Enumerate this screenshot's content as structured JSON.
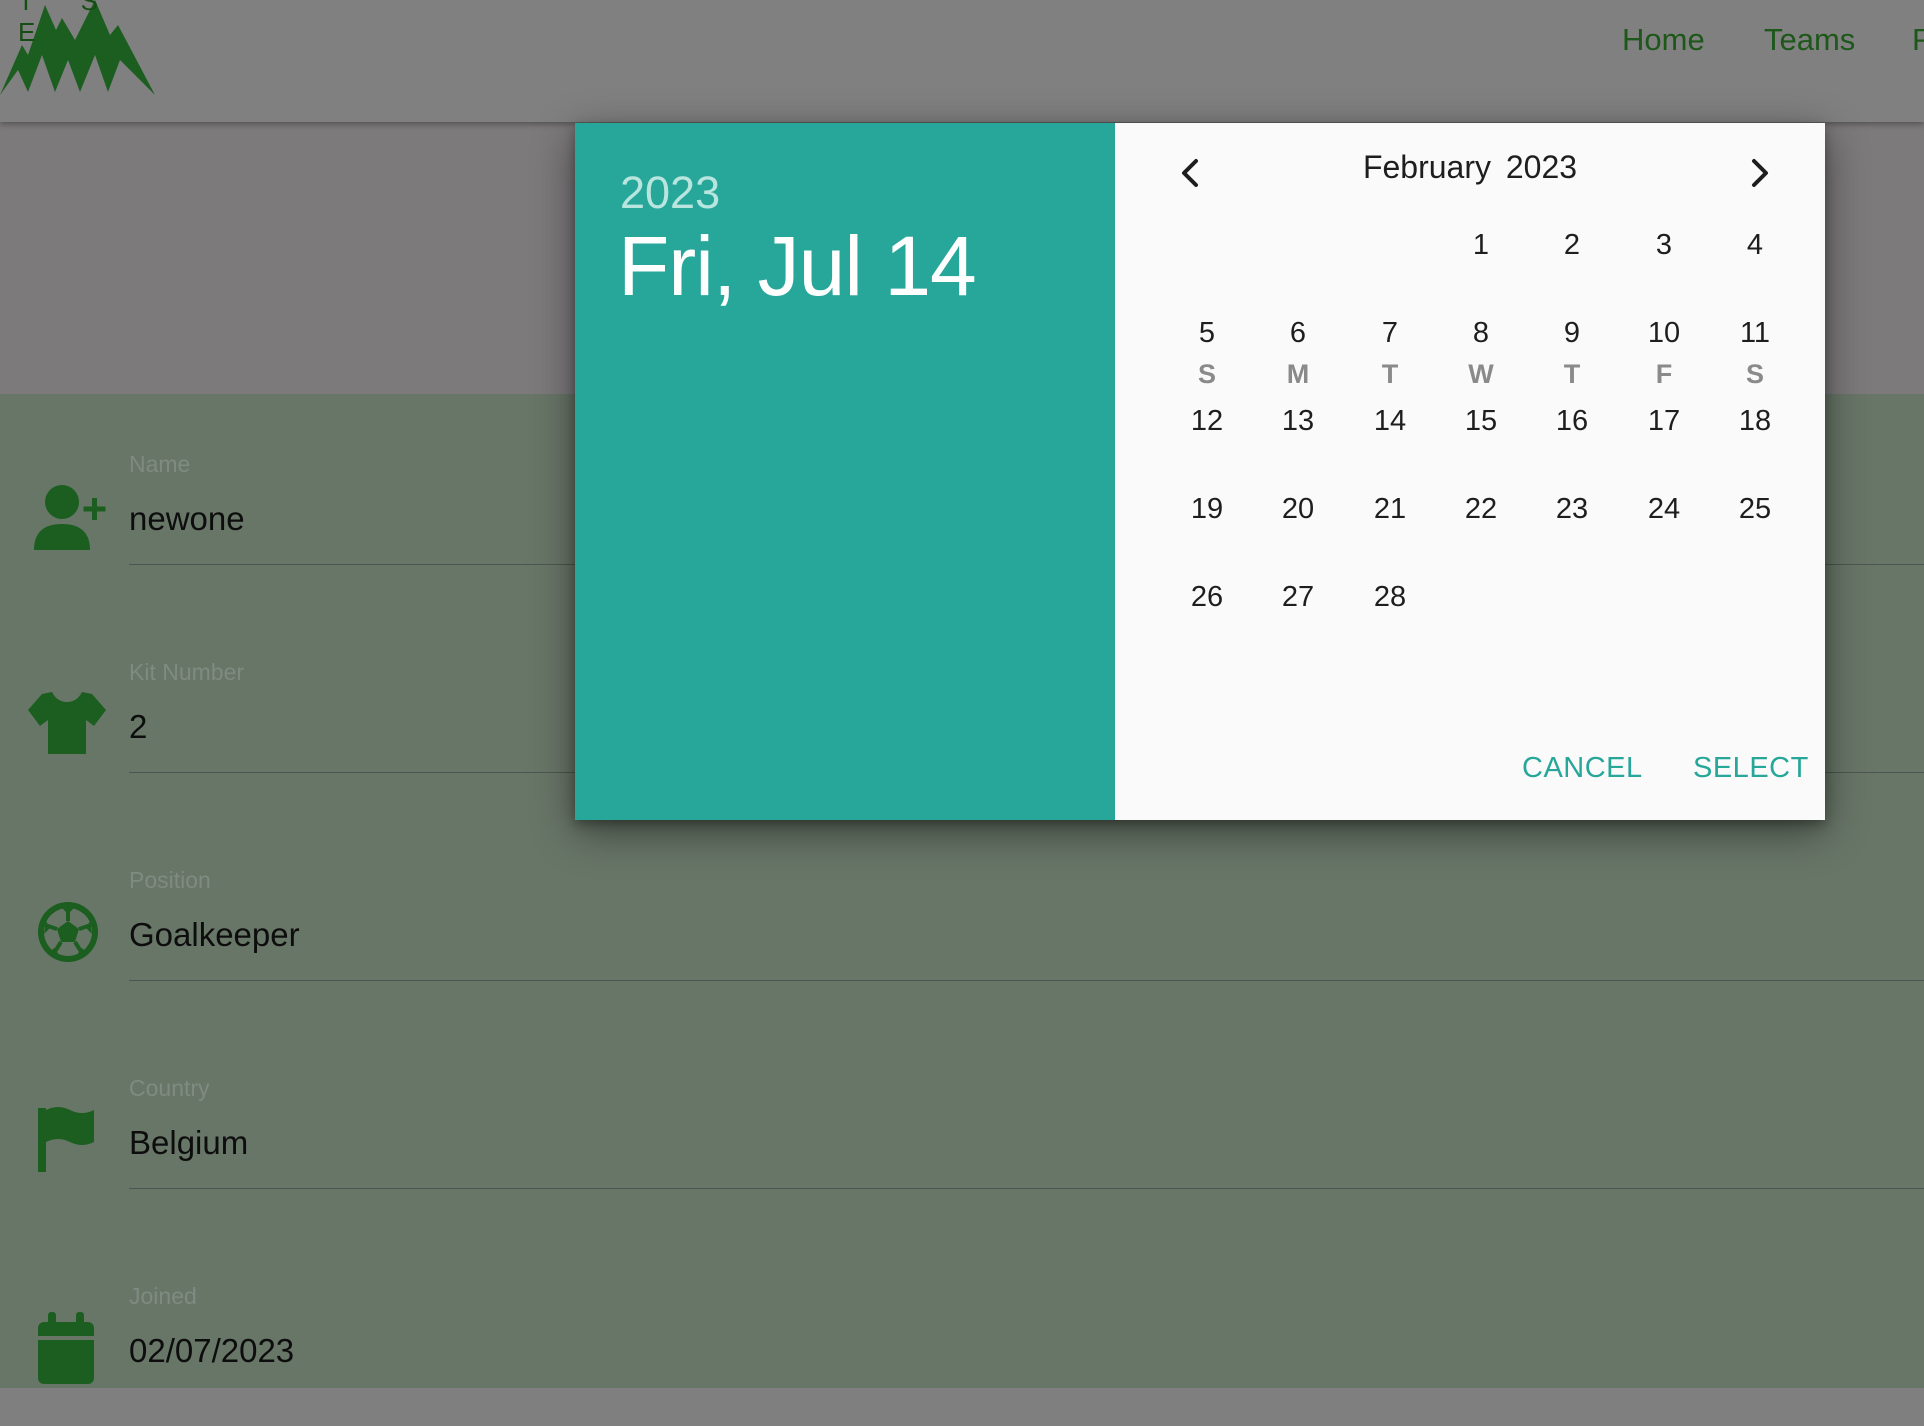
{
  "brand": {
    "logo_letters": "T S E",
    "logo_color": "#1b5e20"
  },
  "nav": {
    "links": [
      "Home",
      "Teams",
      "P"
    ]
  },
  "form": {
    "fields": [
      {
        "label": "Name",
        "value": "newone",
        "icon": "add-user-icon"
      },
      {
        "label": "Kit Number",
        "value": "2",
        "icon": "shirt-icon"
      },
      {
        "label": "Position",
        "value": "Goalkeeper",
        "icon": "soccer-ball-icon"
      },
      {
        "label": "Country",
        "value": "Belgium",
        "icon": "flag-icon"
      },
      {
        "label": "Joined",
        "value": "02/07/2023",
        "icon": "calendar-icon"
      }
    ]
  },
  "datepicker": {
    "header_year": "2023",
    "header_date": "Fri, Jul 14",
    "month_label": "February 2023",
    "weekdays": [
      "S",
      "M",
      "T",
      "W",
      "T",
      "F",
      "S"
    ],
    "leading_blanks": 3,
    "days": [
      "1",
      "2",
      "3",
      "4",
      "5",
      "6",
      "7",
      "8",
      "9",
      "10",
      "11",
      "12",
      "13",
      "14",
      "15",
      "16",
      "17",
      "18",
      "19",
      "20",
      "21",
      "22",
      "23",
      "24",
      "25",
      "26",
      "27",
      "28"
    ],
    "cancel_label": "CANCEL",
    "select_label": "SELECT",
    "accent_color": "#27a69a"
  }
}
